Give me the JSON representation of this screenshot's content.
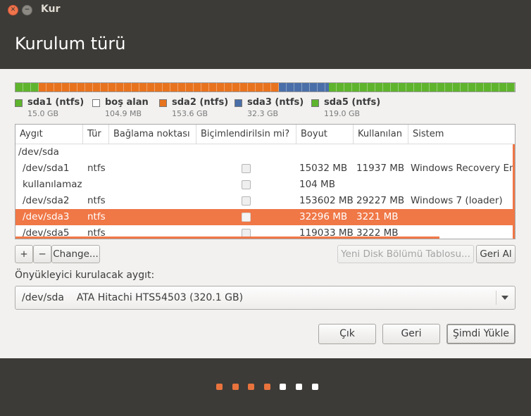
{
  "window": {
    "title": "Kur"
  },
  "header": {
    "title": "Kurulum türü"
  },
  "colors": {
    "green": "#5fb42e",
    "white": "#ffffff",
    "orange": "#e8731f",
    "blue": "#4a6ea8",
    "selection": "#f07746"
  },
  "partitions_bar": [
    {
      "name": "sda1 (ntfs)",
      "size": "15.0 GB",
      "color": "#5fb42e",
      "share": 0.0469
    },
    {
      "name": "boş alan",
      "size": "104.9 MB",
      "color": "#ffffff",
      "share": 0.0003
    },
    {
      "name": "sda2 (ntfs)",
      "size": "153.6 GB",
      "color": "#e8731f",
      "share": 0.48
    },
    {
      "name": "sda3 (ntfs)",
      "size": "32.3 GB",
      "color": "#4a6ea8",
      "share": 0.1009
    },
    {
      "name": "sda5 (ntfs)",
      "size": "119.0 GB",
      "color": "#5fb42e",
      "share": 0.3719
    }
  ],
  "table": {
    "columns": [
      "Aygıt",
      "Tür",
      "Bağlama noktası",
      "Biçimlendirilsin mi?",
      "Boyut",
      "Kullanılan",
      "Sistem"
    ],
    "rows": [
      {
        "device": "/dev/sda",
        "type": "",
        "mount": "",
        "checkbox": false,
        "size": "",
        "used": "",
        "system": "",
        "selected": false
      },
      {
        "device": "/dev/sda1",
        "type": "ntfs",
        "mount": "",
        "checkbox": true,
        "size": "15032 MB",
        "used": "11937 MB",
        "system": "Windows Recovery Em",
        "selected": false
      },
      {
        "device": "kullanılamaz",
        "type": "",
        "mount": "",
        "checkbox": true,
        "size": "104 MB",
        "used": "",
        "system": "",
        "selected": false
      },
      {
        "device": "/dev/sda2",
        "type": "ntfs",
        "mount": "",
        "checkbox": true,
        "size": "153602 MB",
        "used": "29227 MB",
        "system": "Windows 7 (loader)",
        "selected": false
      },
      {
        "device": "/dev/sda3",
        "type": "ntfs",
        "mount": "",
        "checkbox": true,
        "size": "32296 MB",
        "used": "3221 MB",
        "system": "",
        "selected": true
      },
      {
        "device": "/dev/sda5",
        "type": "ntfs",
        "mount": "",
        "checkbox": true,
        "size": "119033 MB",
        "used": "3222 MB",
        "system": "",
        "selected": false
      }
    ]
  },
  "toolbar": {
    "add": "+",
    "remove": "−",
    "change": "Change...",
    "new_table": "Yeni Disk Bölümü Tablosu...",
    "revert": "Geri Al"
  },
  "bootloader": {
    "label": "Önyükleyici kurulacak aygıt:",
    "device": "/dev/sda",
    "description": "ATA Hitachi HTS54503 (320.1 GB)"
  },
  "actions": {
    "quit": "Çık",
    "back": "Geri",
    "install": "Şimdi Yükle"
  },
  "progress": {
    "steps_total": 7,
    "steps_done": 4
  }
}
